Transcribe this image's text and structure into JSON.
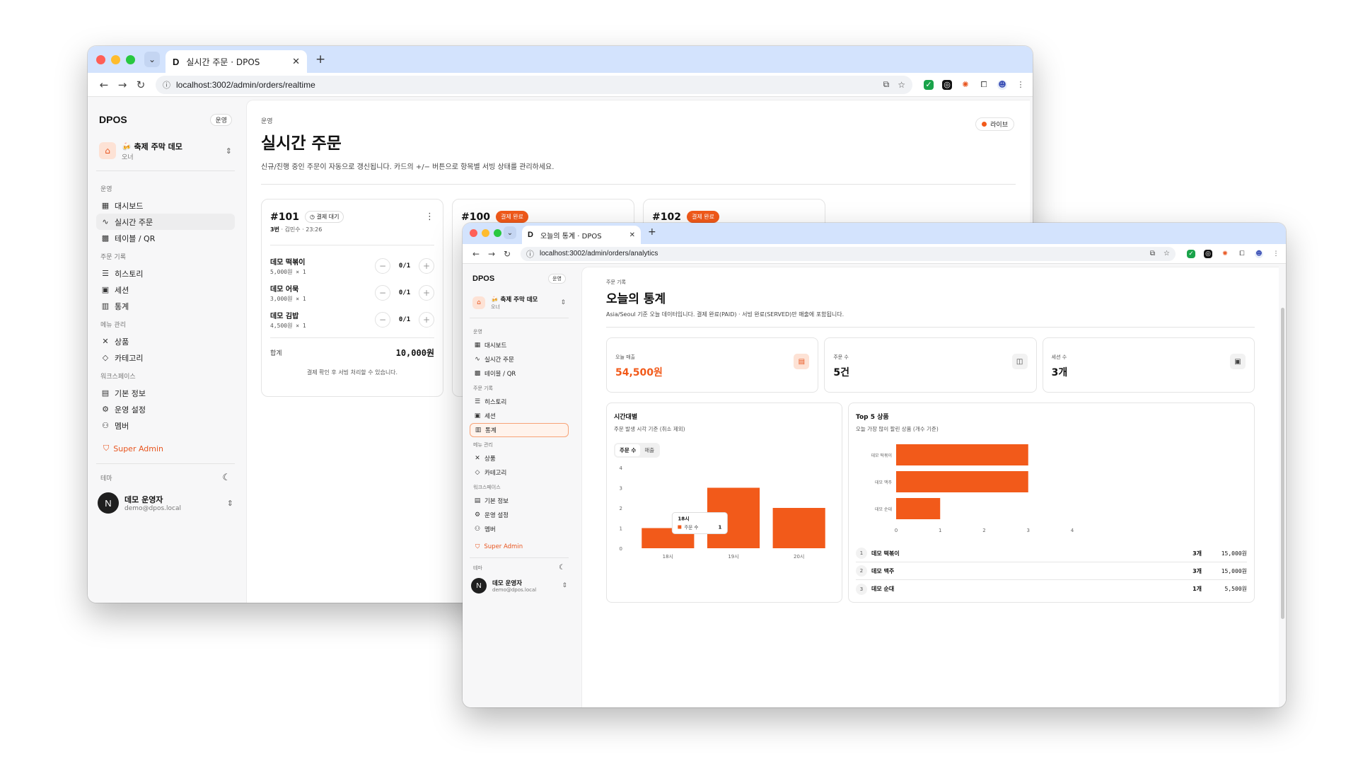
{
  "win1": {
    "tab_title": "실시간 주문 · DPOS",
    "tab_favicon": "D",
    "url": "localhost:3002/admin/orders/realtime",
    "brand": "DPOS",
    "brand_badge": "운영",
    "store_name": "🍻 축제 주막 데모",
    "store_role": "오너",
    "groups": [
      {
        "label": "운영",
        "items": [
          {
            "icon": "dashboard-icon",
            "glyph": "▦",
            "label": "대시보드"
          },
          {
            "icon": "activity-icon",
            "glyph": "∿",
            "label": "실시간 주문"
          },
          {
            "icon": "qr-icon",
            "glyph": "▩",
            "label": "테이블 / QR"
          }
        ]
      },
      {
        "label": "주문 기록",
        "items": [
          {
            "icon": "list-icon",
            "glyph": "☰",
            "label": "히스토리"
          },
          {
            "icon": "calendar-icon",
            "glyph": "▣",
            "label": "세션"
          },
          {
            "icon": "bar-chart-icon",
            "glyph": "▥",
            "label": "통계"
          }
        ]
      },
      {
        "label": "메뉴 관리",
        "items": [
          {
            "icon": "utensils-icon",
            "glyph": "✕",
            "label": "상품"
          },
          {
            "icon": "tag-icon",
            "glyph": "◇",
            "label": "카테고리"
          }
        ]
      },
      {
        "label": "워크스페이스",
        "items": [
          {
            "icon": "building-icon",
            "glyph": "▤",
            "label": "기본 정보"
          },
          {
            "icon": "gear-icon",
            "glyph": "⚙",
            "label": "운영 설정"
          },
          {
            "icon": "users-icon",
            "glyph": "⚇",
            "label": "멤버"
          }
        ]
      }
    ],
    "super_admin": "Super Admin",
    "theme_label": "테마",
    "user_initial": "N",
    "user_name": "데모 운영자",
    "user_email": "demo@dpos.local",
    "crumb": "운영",
    "title": "실시간 주문",
    "desc": "신규/진행 중인 주문이 자동으로 갱신됩니다. 카드의 +/− 버튼으로 항목별 서빙 상태를 관리하세요.",
    "live": "라이브",
    "order": {
      "number": "#101",
      "badge": "결제 대기",
      "table": "3번",
      "meta": " · 김민수 · 23:26",
      "items": [
        {
          "name": "데모 떡볶이",
          "sub": "5,000원 × 1",
          "count": "0/1"
        },
        {
          "name": "데모 어묵",
          "sub": "3,000원 × 1",
          "count": "0/1"
        },
        {
          "name": "데모 김밥",
          "sub": "4,500원 × 1",
          "count": "0/1"
        }
      ],
      "total_label": "합계",
      "total": "10,000원",
      "note": "결제 확인 후 서빙 처리할 수 있습니다."
    },
    "partial_cards": [
      {
        "number": "#100",
        "badge": "결제 완료"
      },
      {
        "number": "#102",
        "badge": "결제 완료"
      }
    ]
  },
  "win2": {
    "tab_title": "오늘의 통계 · DPOS",
    "tab_favicon": "D",
    "url": "localhost:3002/admin/orders/analytics",
    "brand": "DPOS",
    "brand_badge": "운영",
    "store_name": "🍻 축제 주막 데모",
    "store_role": "오너",
    "super_admin": "Super Admin",
    "theme_label": "테마",
    "user_initial": "N",
    "user_name": "데모 운영자",
    "user_email": "demo@dpos.local",
    "crumb": "주문 기록",
    "title": "오늘의 통계",
    "desc": "Asia/Seoul 기준 오늘 데이터입니다. 결제 완료(PAID) · 서빙 완료(SERVED)만 매출에 포함됩니다.",
    "kpis": [
      {
        "label": "오늘 매출",
        "value": "54,500원",
        "icon": "receipt-icon",
        "glyph": "▤",
        "accent": true
      },
      {
        "label": "주문 수",
        "value": "5건",
        "icon": "bag-icon",
        "glyph": "◫",
        "accent": false
      },
      {
        "label": "세션 수",
        "value": "3개",
        "icon": "calendar-icon",
        "glyph": "▣",
        "accent": false
      }
    ],
    "hour_panel": {
      "title": "시간대별",
      "subtitle": "주문 발생 시각 기준 (취소 제외)",
      "seg_on": "주문 수",
      "seg_off": "매출",
      "tooltip_title": "18시",
      "tooltip_label": "주문 수",
      "tooltip_value": "1"
    },
    "top_panel": {
      "title": "Top 5 상품",
      "subtitle": "오늘 가장 많이 팔린 상품 (개수 기준)",
      "ranks": [
        {
          "no": "1",
          "name": "데모 떡볶이",
          "qty": "3개",
          "amount": "15,000원"
        },
        {
          "no": "2",
          "name": "데모 맥주",
          "qty": "3개",
          "amount": "15,000원"
        },
        {
          "no": "3",
          "name": "데모 순대",
          "qty": "1개",
          "amount": "5,500원"
        }
      ]
    }
  },
  "accent_color": "#f25a1a",
  "chart_data": [
    {
      "type": "bar",
      "title": "시간대별",
      "categories": [
        "18시",
        "19시",
        "20시"
      ],
      "values": [
        1,
        3,
        2
      ],
      "ylim": [
        0,
        4
      ],
      "yticks": [
        "0",
        "1",
        "2",
        "3",
        "4"
      ],
      "grid": false
    },
    {
      "type": "bar",
      "orientation": "horizontal",
      "title": "Top 5 상품",
      "categories": [
        "데모 떡볶이",
        "데모 맥주",
        "데모 순대"
      ],
      "values": [
        3,
        3,
        1
      ],
      "xlim": [
        0,
        4
      ],
      "xticks": [
        "0",
        "1",
        "2",
        "3",
        "4"
      ],
      "grid": false
    }
  ]
}
